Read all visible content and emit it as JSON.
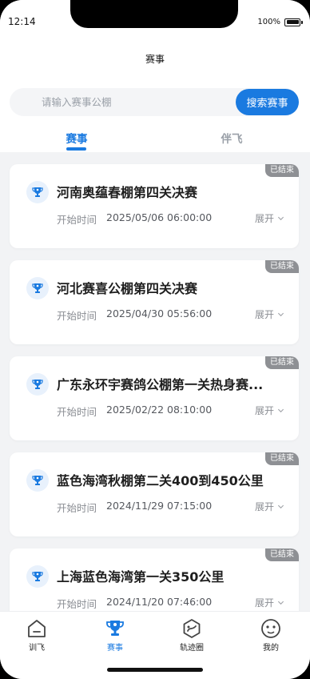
{
  "status_bar": {
    "time": "12:14",
    "battery": "100%"
  },
  "header": {
    "title": "赛事"
  },
  "search": {
    "placeholder": "请输入赛事公棚",
    "button_label": "搜索赛事"
  },
  "tabs": [
    {
      "label": "赛事",
      "active": true
    },
    {
      "label": "伴飞",
      "active": false
    }
  ],
  "events": [
    {
      "status": "已结束",
      "title": "河南奥蕴春棚第四关决赛",
      "start_label": "开始时间",
      "start_time": "2025/05/06 06:00:00",
      "expand_label": "展开"
    },
    {
      "status": "已结束",
      "title": "河北赛喜公棚第四关决赛",
      "start_label": "开始时间",
      "start_time": "2025/04/30 05:56:00",
      "expand_label": "展开"
    },
    {
      "status": "已结束",
      "title": "广东永环宇赛鸽公棚第一关热身赛...",
      "start_label": "开始时间",
      "start_time": "2025/02/22 08:10:00",
      "expand_label": "展开"
    },
    {
      "status": "已结束",
      "title": "蓝色海湾秋棚第二关400到450公里",
      "start_label": "开始时间",
      "start_time": "2024/11/29 07:15:00",
      "expand_label": "展开"
    },
    {
      "status": "已结束",
      "title": "上海蓝色海湾第一关350公里",
      "start_label": "开始时间",
      "start_time": "2024/11/20 07:46:00",
      "expand_label": "展开"
    }
  ],
  "bottom_nav": [
    {
      "label": "训飞",
      "icon": "house-icon",
      "active": false
    },
    {
      "label": "赛事",
      "icon": "trophy-icon",
      "active": true
    },
    {
      "label": "轨迹圈",
      "icon": "track-icon",
      "active": false
    },
    {
      "label": "我的",
      "icon": "face-icon",
      "active": false
    }
  ],
  "colors": {
    "accent": "#1a7ae0",
    "badge": "#8e9094",
    "background": "#f2f3f5"
  }
}
